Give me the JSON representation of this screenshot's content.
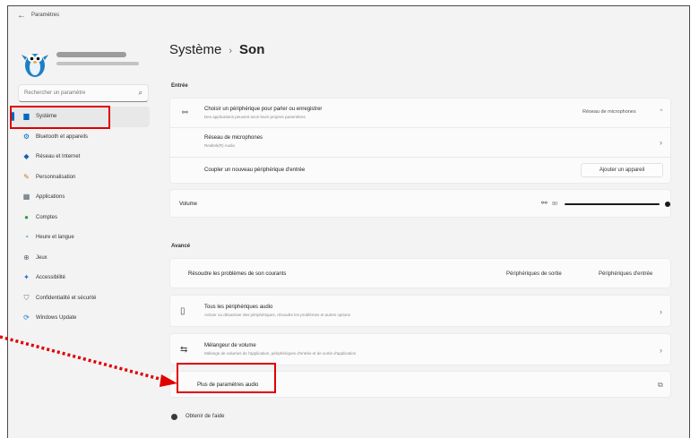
{
  "titlebar": {
    "back_icon": "←",
    "app_title": "Paramètres"
  },
  "user": {
    "avatar_icon": "penguin-avatar"
  },
  "search": {
    "placeholder": "Rechercher un paramètre",
    "icon": "⌕"
  },
  "sidebar": {
    "items": [
      {
        "label": "Système",
        "icon": "▆",
        "color": "#0067c0",
        "active": true
      },
      {
        "label": "Bluetooth et appareils",
        "icon": "⚙",
        "color": "#0067c0"
      },
      {
        "label": "Réseau et Internet",
        "icon": "◆",
        "color": "#1a5fb4"
      },
      {
        "label": "Personnalisation",
        "icon": "✎",
        "color": "#c97c1c"
      },
      {
        "label": "Applications",
        "icon": "▦",
        "color": "#4a5a6a"
      },
      {
        "label": "Comptes",
        "icon": "●",
        "color": "#2e9e3e"
      },
      {
        "label": "Heure et langue",
        "icon": "◔",
        "color": "#1a7fd4"
      },
      {
        "label": "Jeux",
        "icon": "⊕",
        "color": "#5a6a7a"
      },
      {
        "label": "Accessibilité",
        "icon": "✦",
        "color": "#2a6ad4"
      },
      {
        "label": "Confidentialité et sécurité",
        "icon": "⛉",
        "color": "#6a7a8a"
      },
      {
        "label": "Windows Update",
        "icon": "⟳",
        "color": "#1a7fd4"
      }
    ]
  },
  "breadcrumb": {
    "parent": "Système",
    "separator": "›",
    "current": "Son"
  },
  "entree": {
    "section_title": "Entrée",
    "choose_device": {
      "icon": "🎙",
      "title": "Choisir un périphérique pour parler ou enregistrer",
      "subtitle": "Des applications peuvent avoir leurs propres paramètres",
      "dropdown_value": "Réseau de microphones",
      "dropdown_icon": "⌃"
    },
    "mic_array": {
      "title": "Réseau de microphones",
      "subtitle": "Realtek(R) Audio",
      "chevron": "›"
    },
    "pair": {
      "label": "Coupler un nouveau périphérique d'entrée",
      "button": "Ajouter un appareil"
    },
    "volume": {
      "label": "Volume",
      "mic_icon": "🎙",
      "value": "90"
    }
  },
  "avance": {
    "section_title": "Avancé",
    "troubleshoot": {
      "label": "Résoudre les problèmes de son courants",
      "output_button": "Périphériques de sortie",
      "input_button": "Périphériques d'entrée"
    },
    "all_devices": {
      "icon": "▯",
      "title": "Tous les périphériques audio",
      "subtitle": "Activer ou désactiver des périphériques, résoudre les problèmes et autres options",
      "chevron": "›"
    },
    "mixer": {
      "icon": "⇆",
      "title": "Mélangeur de volume",
      "subtitle": "Mélange de volumes de l'application, périphériques d'entrée et de sortie d'application",
      "chevron": "›"
    },
    "more": {
      "label": "Plus de paramètres audio",
      "icon": "⧉"
    }
  },
  "help": {
    "icon": "●",
    "label": "Obtenir de l'aide"
  },
  "annotations": {
    "highlight_color": "#e00000"
  }
}
